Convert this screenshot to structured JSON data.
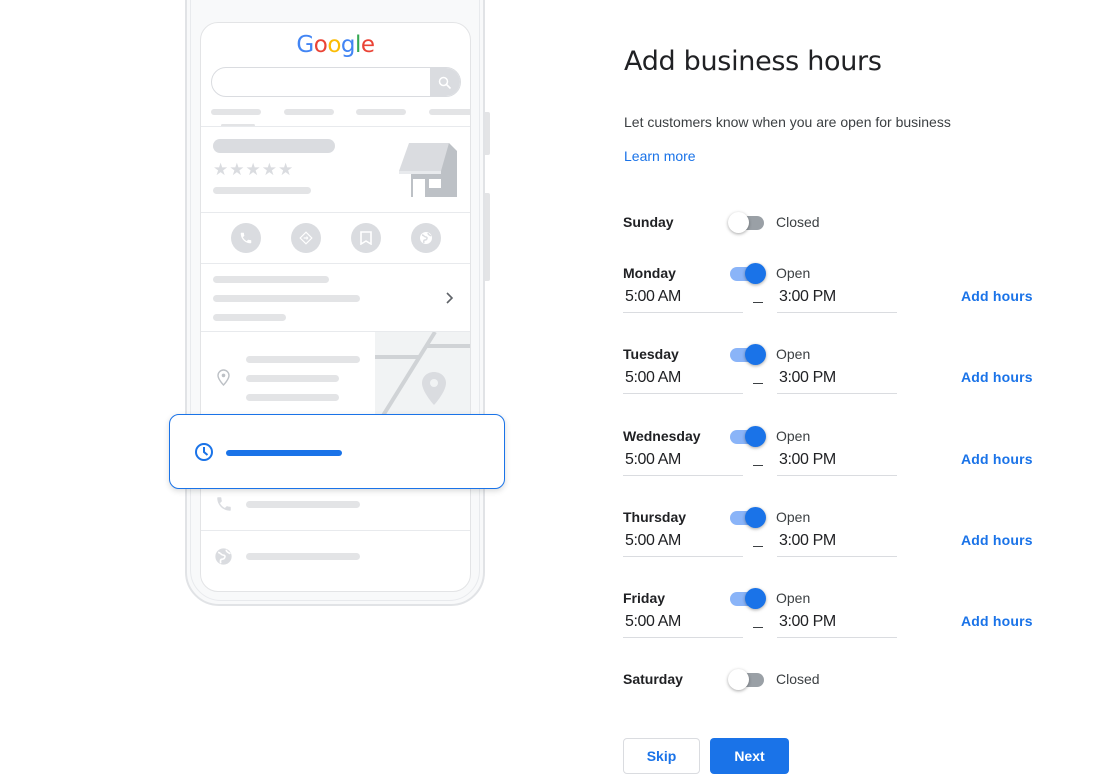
{
  "illustration": {
    "logo": {
      "letters": [
        {
          "char": "G",
          "color": "#4285f4"
        },
        {
          "char": "o",
          "color": "#ea4335"
        },
        {
          "char": "o",
          "color": "#fbbc05"
        },
        {
          "char": "g",
          "color": "#4285f4"
        },
        {
          "char": "l",
          "color": "#34a853"
        },
        {
          "char": "e",
          "color": "#ea4335"
        }
      ]
    },
    "icons": [
      "search-icon",
      "storefront-icon",
      "phone-icon",
      "directions-icon",
      "bookmark-icon",
      "globe-icon",
      "chevron-right-icon",
      "location-pin-icon",
      "map-pin-icon",
      "clock-icon"
    ],
    "rating_stars": 5
  },
  "form": {
    "title": "Add business hours",
    "subtitle": "Let customers know when you are open for business",
    "learn_more": "Learn more",
    "days": [
      {
        "name": "Sunday",
        "open": false,
        "status": "Closed"
      },
      {
        "name": "Monday",
        "open": true,
        "status": "Open",
        "from": "5:00 AM",
        "to": "3:00 PM",
        "add_hours": "Add hours"
      },
      {
        "name": "Tuesday",
        "open": true,
        "status": "Open",
        "from": "5:00 AM",
        "to": "3:00 PM",
        "add_hours": "Add hours"
      },
      {
        "name": "Wednesday",
        "open": true,
        "status": "Open",
        "from": "5:00 AM",
        "to": "3:00 PM",
        "add_hours": "Add hours"
      },
      {
        "name": "Thursday",
        "open": true,
        "status": "Open",
        "from": "5:00 AM",
        "to": "3:00 PM",
        "add_hours": "Add hours"
      },
      {
        "name": "Friday",
        "open": true,
        "status": "Open",
        "from": "5:00 AM",
        "to": "3:00 PM",
        "add_hours": "Add hours"
      },
      {
        "name": "Saturday",
        "open": false,
        "status": "Closed"
      }
    ],
    "skip_label": "Skip",
    "next_label": "Next"
  },
  "colors": {
    "accent": "#1a73e8",
    "accent_light": "#8ab4f8",
    "toggle_off": "#9aa0a6",
    "skeleton": "#dadce0"
  }
}
